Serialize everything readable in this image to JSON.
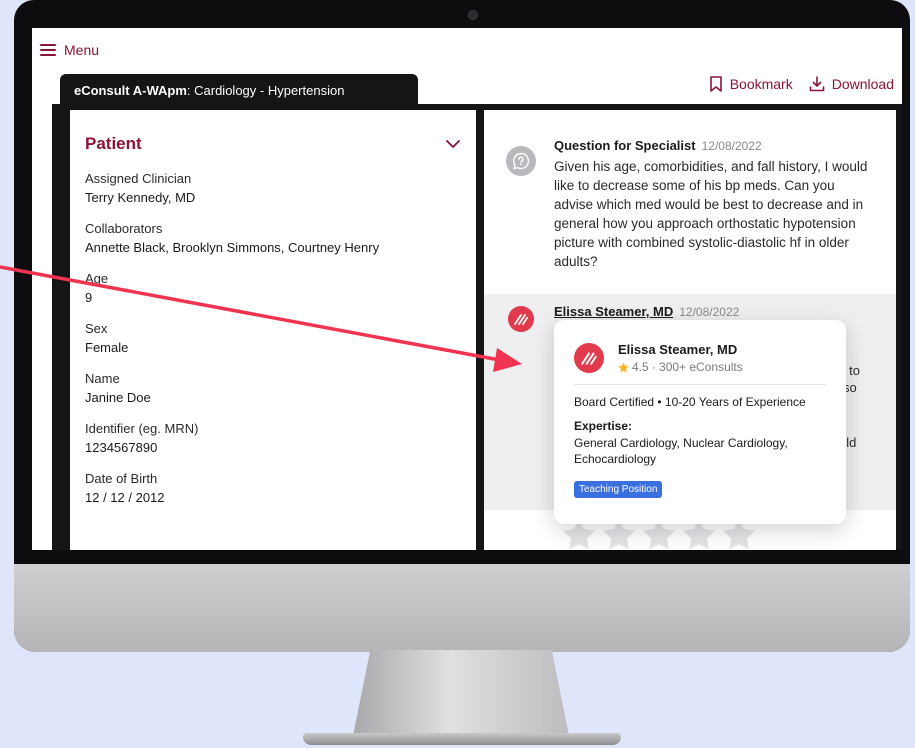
{
  "menu": {
    "label": "Menu"
  },
  "tab": {
    "consult_id": "eConsult A-WApm",
    "specialty": ": Cardiology - Hypertension"
  },
  "actions": {
    "bookmark": "Bookmark",
    "download": "Download"
  },
  "patient": {
    "title": "Patient",
    "fields": [
      {
        "label": "Assigned Clinician",
        "value": "Terry Kennedy, MD"
      },
      {
        "label": "Collaborators",
        "value": "Annette Black, Brooklyn Simmons, Courtney Henry"
      },
      {
        "label": "Age",
        "value": "9"
      },
      {
        "label": "Sex",
        "value": "Female"
      },
      {
        "label": "Name",
        "value": "Janine Doe"
      },
      {
        "label": "Identifier (eg. MRN)",
        "value": "1234567890"
      },
      {
        "label": "Date of Birth",
        "value": "12 / 12 / 2012"
      }
    ]
  },
  "conversation": {
    "question": {
      "author": "Question for Specialist",
      "date": "12/08/2022",
      "body": "Given his age, comorbidities, and fall history, I would like to decrease some of his bp meds. Can you advise which med would be best to decrease and in general how you approach orthostatic hypotension picture with combined systolic-diastolic hf in older adults?"
    },
    "reply": {
      "author": "Elissa Steamer, MD",
      "date": "12/08/2022",
      "peek": [
        "d",
        "s to",
        "so",
        "uld"
      ]
    }
  },
  "popover": {
    "name": "Elissa Steamer, MD",
    "rating": "4.5",
    "consults": "· 300+ eConsults",
    "credentials": "Board Certified  •  10-20 Years of Experience",
    "expertise_label": "Expertise:",
    "expertise": "General Cardiology, Nuclear Cardiology, Echocardiology",
    "badge": "Teaching Position"
  },
  "colors": {
    "brand": "#8b1437",
    "avatar": "#e23a4d",
    "badge": "#3a6fe0",
    "arrow": "#f0344f",
    "star": "#f5b82e"
  },
  "icons": [
    "hamburger-icon",
    "bookmark-icon",
    "download-icon",
    "chevron-down-icon",
    "question-icon",
    "doctor-logo-icon",
    "star-icon"
  ]
}
